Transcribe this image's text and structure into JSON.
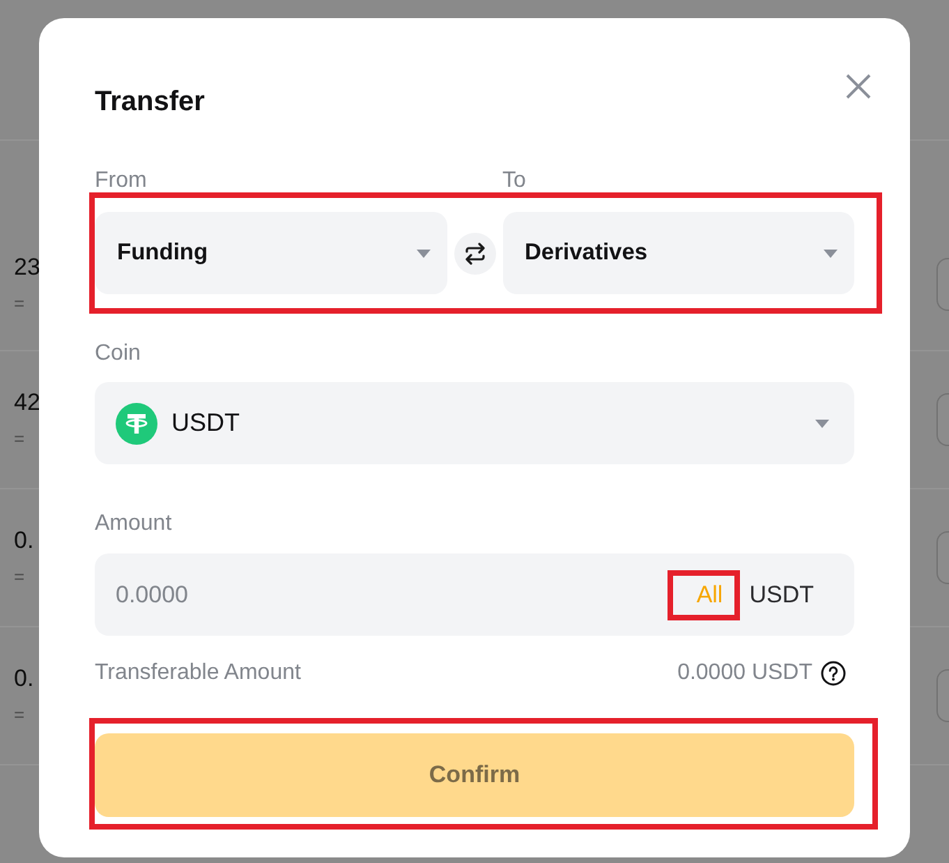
{
  "background_page": {
    "rows": [
      {
        "amount": "23",
        "approx": "="
      },
      {
        "amount": "42",
        "approx": "="
      },
      {
        "amount": "0.",
        "approx": "="
      },
      {
        "amount": "0.",
        "approx": "="
      }
    ]
  },
  "dialog": {
    "title": "Transfer",
    "transfer_route": {
      "highlighted": true,
      "from": {
        "label": "From",
        "value": "Funding"
      },
      "to": {
        "label": "To",
        "value": "Derivatives"
      }
    },
    "coin": {
      "label": "Coin",
      "value": "USDT"
    },
    "amount": {
      "label": "Amount",
      "placeholder": "0.0000",
      "all_button": {
        "label": "All",
        "highlighted": true
      },
      "unit": "USDT"
    },
    "transferable": {
      "label": "Transferable Amount",
      "value": "0.0000 USDT"
    },
    "confirm_button": {
      "label": "Confirm",
      "disabled": true,
      "highlighted": true
    }
  }
}
